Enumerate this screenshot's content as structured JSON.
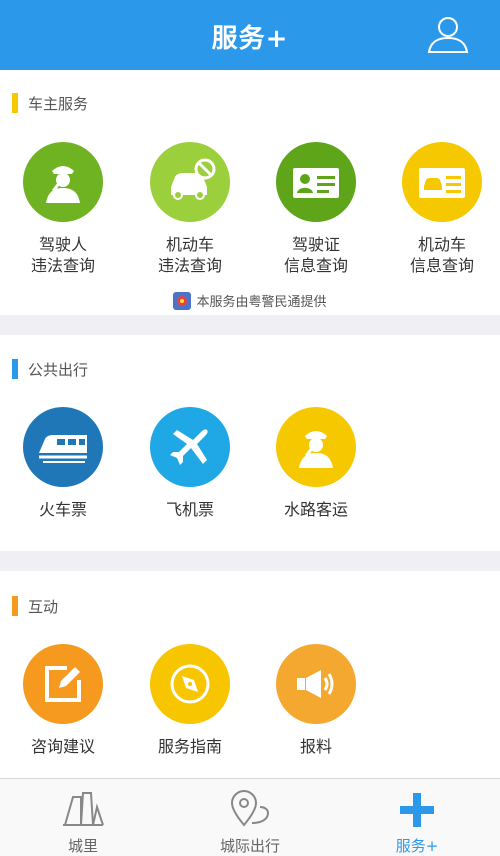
{
  "header": {
    "title": "服务+",
    "user_icon": "user-icon"
  },
  "sections": [
    {
      "label": "车主服务",
      "accent": "#f5c800",
      "items": [
        {
          "line1": "驾驶人",
          "line2": "违法查询",
          "color": "#6fb322",
          "icon": "police-officer-icon"
        },
        {
          "line1": "机动车",
          "line2": "违法查询",
          "color": "#9ccf3c",
          "icon": "car-prohibited-icon"
        },
        {
          "line1": "驾驶证",
          "line2": "信息查询",
          "color": "#5ea51a",
          "icon": "driver-license-icon"
        },
        {
          "line1": "机动车",
          "line2": "信息查询",
          "color": "#f5c800",
          "icon": "vehicle-license-icon"
        }
      ],
      "provider": "本服务由粤警民通提供"
    },
    {
      "label": "公共出行",
      "accent": "#2b98ea",
      "items": [
        {
          "line1": "火车票",
          "color": "#1f77b8",
          "icon": "train-icon"
        },
        {
          "line1": "飞机票",
          "color": "#1fa7e6",
          "icon": "airplane-icon"
        },
        {
          "line1": "水路客运",
          "color": "#f5c800",
          "icon": "captain-icon"
        }
      ]
    },
    {
      "label": "互动",
      "accent": "#f59a1e",
      "items": [
        {
          "line1": "咨询建议",
          "color": "#f59a1e",
          "icon": "edit-icon"
        },
        {
          "line1": "服务指南",
          "color": "#f7c600",
          "icon": "compass-icon"
        },
        {
          "line1": "报料",
          "color": "#f5a830",
          "icon": "megaphone-icon"
        }
      ]
    }
  ],
  "tabs": [
    {
      "label": "城里",
      "icon": "city-buildings-icon",
      "active": false
    },
    {
      "label": "城际出行",
      "icon": "location-route-icon",
      "active": false
    },
    {
      "label": "服务+",
      "icon": "plus-icon",
      "active": true
    }
  ],
  "colors": {
    "primary": "#2b98ea",
    "background": "#efeff4"
  }
}
